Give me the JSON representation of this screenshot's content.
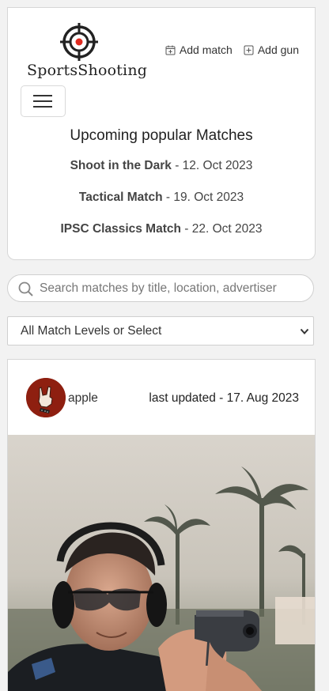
{
  "header": {
    "logo_text": "SportsShooting",
    "links": [
      {
        "label": "Add match",
        "icon": "calendar-plus-icon"
      },
      {
        "label": "Add gun",
        "icon": "plus-square-icon"
      }
    ],
    "menu_icon": "hamburger-icon"
  },
  "popular": {
    "title": "Upcoming popular Matches",
    "matches": [
      {
        "name": "Shoot in the Dark",
        "date": " - 12. Oct 2023"
      },
      {
        "name": "Tactical Match",
        "date": " - 19. Oct 2023"
      },
      {
        "name": "IPSC Classics Match",
        "date": " - 22. Oct 2023"
      }
    ]
  },
  "search": {
    "placeholder": "Search matches by title, location, advertiser",
    "value": "",
    "icon": "search-icon"
  },
  "level_select": {
    "selected": "All Match Levels or Select"
  },
  "card": {
    "user": "apple",
    "updated": "last updated - 17. Aug 2023"
  },
  "colors": {
    "accent": "#e02b20",
    "avatar_bg": "#8e1f10",
    "page_bg": "#f2f2f2"
  }
}
